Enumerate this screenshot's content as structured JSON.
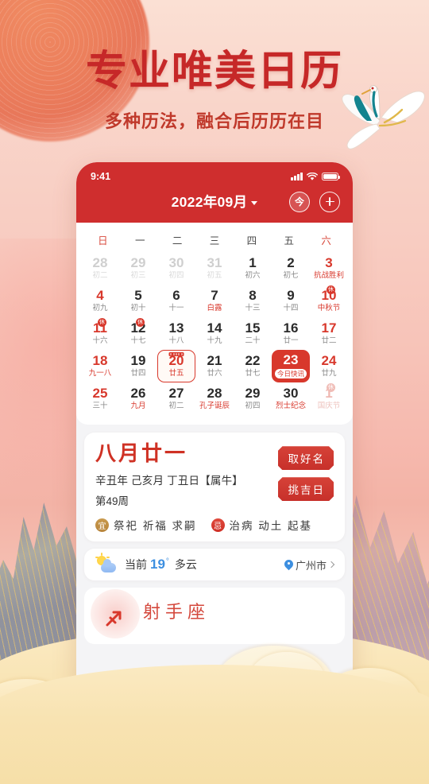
{
  "promo": {
    "headline": "专业唯美日历",
    "subhead": "多种历法，融合后历历在目"
  },
  "status_bar": {
    "time": "9:41",
    "signal_icon": "signal-bars-icon",
    "wifi_icon": "wifi-icon",
    "battery_icon": "battery-icon"
  },
  "app_header": {
    "month_title": "2022年09月",
    "dropdown_icon": "chevron-down-icon",
    "today_button": "今",
    "add_button": "+"
  },
  "calendar": {
    "weekdays": [
      "日",
      "一",
      "二",
      "三",
      "四",
      "五",
      "六"
    ],
    "cells": [
      {
        "day": "28",
        "sub": "初二",
        "out": true
      },
      {
        "day": "29",
        "sub": "初三",
        "out": true
      },
      {
        "day": "30",
        "sub": "初四",
        "out": true
      },
      {
        "day": "31",
        "sub": "初五",
        "out": true
      },
      {
        "day": "1",
        "sub": "初六"
      },
      {
        "day": "2",
        "sub": "初七"
      },
      {
        "day": "3",
        "sub": "抗战胜利",
        "red": true,
        "redsub": true
      },
      {
        "day": "4",
        "sub": "初九",
        "red": true
      },
      {
        "day": "5",
        "sub": "初十"
      },
      {
        "day": "6",
        "sub": "十一"
      },
      {
        "day": "7",
        "sub": "白露",
        "redsub": true
      },
      {
        "day": "8",
        "sub": "十三"
      },
      {
        "day": "9",
        "sub": "十四"
      },
      {
        "day": "10",
        "sub": "中秋节",
        "red": true,
        "redsub": true,
        "badge": "休"
      },
      {
        "day": "11",
        "sub": "十六",
        "red": true,
        "badge": "休"
      },
      {
        "day": "12",
        "sub": "十七",
        "badge": "休"
      },
      {
        "day": "13",
        "sub": "十八"
      },
      {
        "day": "14",
        "sub": "十九"
      },
      {
        "day": "15",
        "sub": "二十"
      },
      {
        "day": "16",
        "sub": "廿一"
      },
      {
        "day": "17",
        "sub": "廿二",
        "red": true
      },
      {
        "day": "18",
        "sub": "九一八",
        "red": true,
        "redsub": true
      },
      {
        "day": "19",
        "sub": "廿四"
      },
      {
        "day": "20",
        "sub": "廿五",
        "selected": true
      },
      {
        "day": "21",
        "sub": "廿六"
      },
      {
        "day": "22",
        "sub": "廿七"
      },
      {
        "day": "23",
        "sub": "今日快讯",
        "today": true
      },
      {
        "day": "24",
        "sub": "廿九",
        "red": true
      },
      {
        "day": "25",
        "sub": "三十",
        "red": true
      },
      {
        "day": "26",
        "sub": "九月",
        "redsub": true
      },
      {
        "day": "27",
        "sub": "初二"
      },
      {
        "day": "28",
        "sub": "孔子诞辰",
        "redsub": true
      },
      {
        "day": "29",
        "sub": "初四"
      },
      {
        "day": "30",
        "sub": "烈士纪念",
        "redsub": true
      },
      {
        "day": "1",
        "sub": "国庆节",
        "out": true,
        "redout": true,
        "badge": "休",
        "badge_pale": true
      }
    ]
  },
  "detail_card": {
    "lunar_date": "八月廿一",
    "ganzhi": "辛丑年 己亥月 丁丑日【属牛】",
    "week_number": "第49周",
    "buttons": [
      "取好名",
      "挑吉日"
    ],
    "yi_label": "宜",
    "yi_items": "祭祀 祈福 求嗣",
    "ji_label": "忌",
    "ji_items": "治病 动土 起基"
  },
  "weather": {
    "icon": "sun-cloud-icon",
    "prefix": "当前",
    "temperature": "19",
    "degree": "°",
    "condition": "多云",
    "location_icon": "location-pin-icon",
    "location": "广州市",
    "chevron_icon": "chevron-right-icon"
  },
  "zodiac": {
    "icon": "sagittarius-icon",
    "name": "射手座"
  },
  "colors": {
    "brand_red": "#cf2e2e",
    "accent_red": "#d8382c",
    "gold": "#c99a4e",
    "weather_blue": "#3d8fe0",
    "bg_pink": "#f8cdc2",
    "bg_gold": "#f8e3b4"
  }
}
